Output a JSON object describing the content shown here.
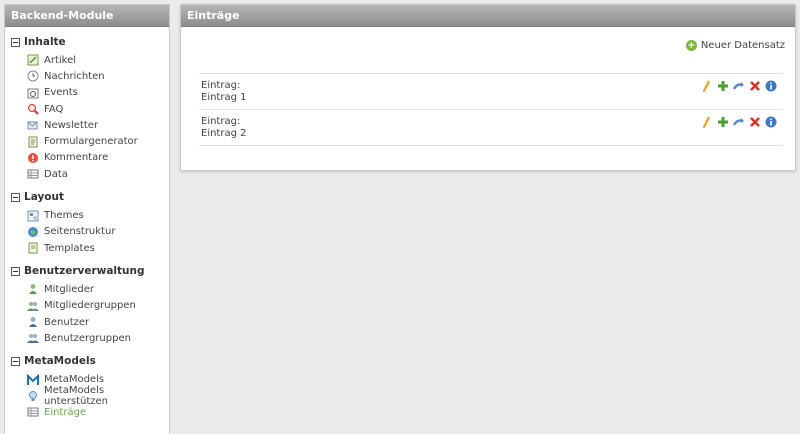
{
  "sidebar": {
    "title": "Backend-Module",
    "groups": [
      {
        "title": "Inhalte",
        "items": [
          "Artikel",
          "Nachrichten",
          "Events",
          "FAQ",
          "Newsletter",
          "Formulargenerator",
          "Kommentare",
          "Data"
        ]
      },
      {
        "title": "Layout",
        "items": [
          "Themes",
          "Seitenstruktur",
          "Templates"
        ]
      },
      {
        "title": "Benutzerverwaltung",
        "items": [
          "Mitglieder",
          "Mitgliedergruppen",
          "Benutzer",
          "Benutzergruppen"
        ]
      },
      {
        "title": "MetaModels",
        "items": [
          "MetaModels",
          "MetaModels unterstützen",
          "Einträge"
        ]
      }
    ]
  },
  "main": {
    "title": "Einträge",
    "new_button": "Neuer Datensatz",
    "rows": [
      {
        "label": "Eintrag:",
        "value": "Eintrag 1"
      },
      {
        "label": "Eintrag:",
        "value": "Eintrag 2"
      }
    ]
  },
  "colors": {
    "active_item": "#6aa84f",
    "header_gradient_top": "#b6b6b6",
    "header_gradient_bottom": "#8d8d8d"
  }
}
